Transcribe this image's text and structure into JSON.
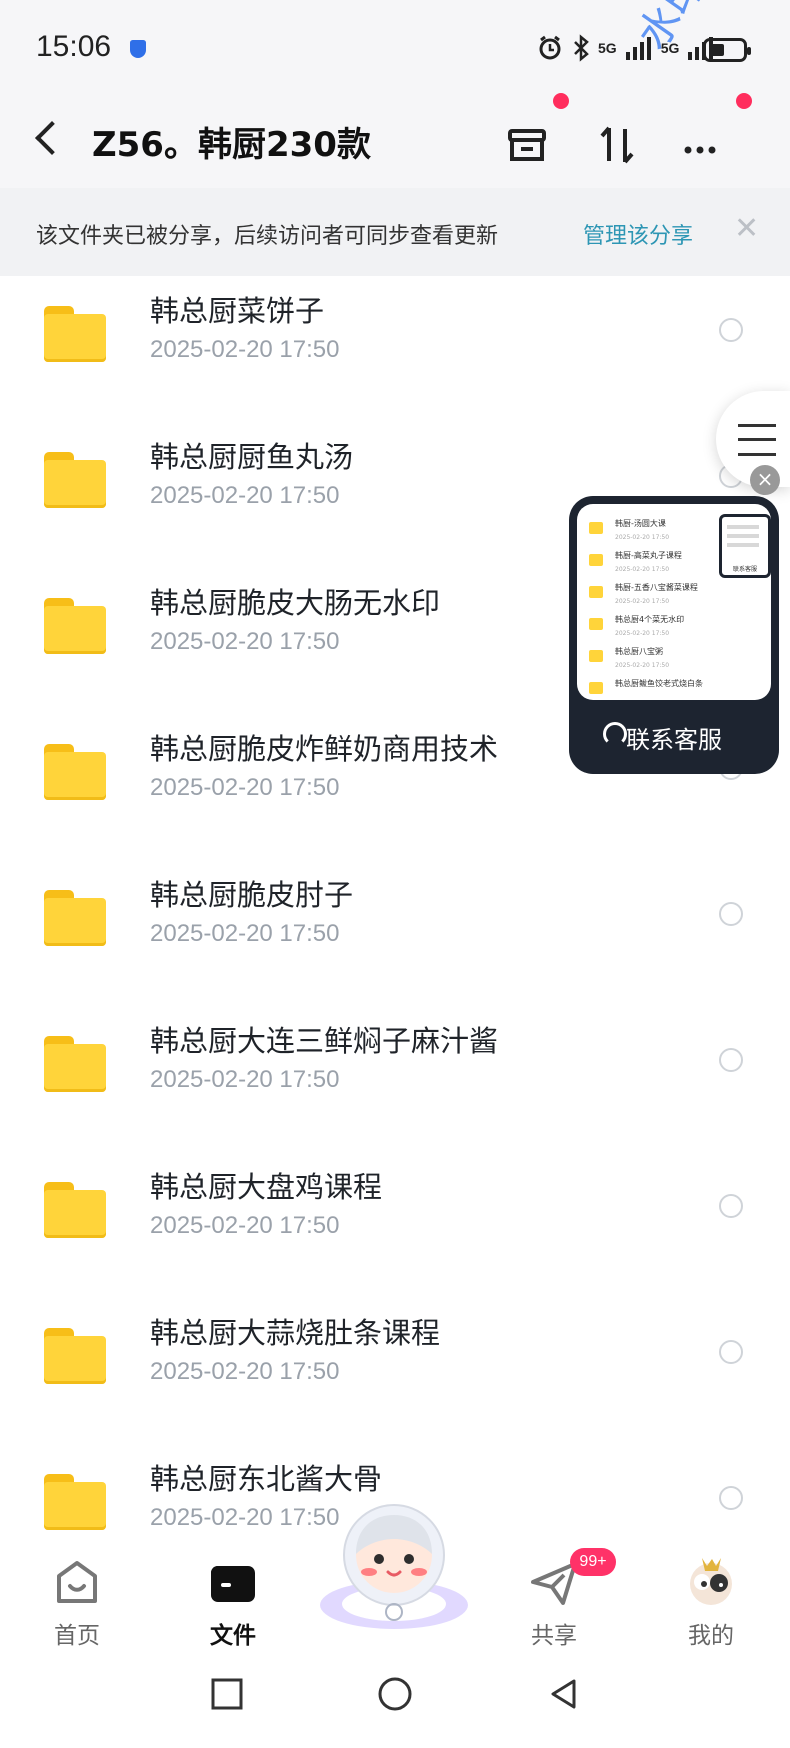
{
  "status_bar": {
    "time": "15:06",
    "network_1": "5G",
    "network_2": "5G",
    "watermark": "水印文字"
  },
  "header": {
    "title": "Z56。韩厨230款"
  },
  "share_banner": {
    "text": "该文件夹已被分享，后续访问者可同步查看更新",
    "manage_link": "管理该分享"
  },
  "files": [
    {
      "name": "韩总厨菜饼子",
      "date": "2025-02-20  17:50"
    },
    {
      "name": "韩总厨厨鱼丸汤",
      "date": "2025-02-20  17:50"
    },
    {
      "name": "韩总厨脆皮大肠无水印",
      "date": "2025-02-20  17:50"
    },
    {
      "name": "韩总厨脆皮炸鲜奶商用技术",
      "date": "2025-02-20  17:50"
    },
    {
      "name": "韩总厨脆皮肘子",
      "date": "2025-02-20  17:50"
    },
    {
      "name": "韩总厨大连三鲜焖子麻汁酱",
      "date": "2025-02-20  17:50"
    },
    {
      "name": "韩总厨大盘鸡课程",
      "date": "2025-02-20  17:50"
    },
    {
      "name": "韩总厨大蒜烧肚条课程",
      "date": "2025-02-20  17:50"
    },
    {
      "name": "韩总厨东北酱大骨",
      "date": "2025-02-20  17:50"
    }
  ],
  "support": {
    "label": "联系客服",
    "preview_items": [
      {
        "name": "韩厨-汤圆大课",
        "date": "2025-02-20  17:50"
      },
      {
        "name": "韩厨-高菜丸子课程",
        "date": "2025-02-20  17:50"
      },
      {
        "name": "韩厨-五香八宝酱菜课程",
        "date": "2025-02-20  17:50"
      },
      {
        "name": "韩总厨4个菜无水印",
        "date": "2025-02-20  17:50"
      },
      {
        "name": "韩总厨八宝粥",
        "date": "2025-02-20  17:50"
      },
      {
        "name": "韩总厨鲅鱼饺老式烧白条",
        "date": ""
      }
    ],
    "preview_phone_label": "联系客服"
  },
  "bottom_nav": {
    "tabs": [
      {
        "label": "首页",
        "active": false
      },
      {
        "label": "文件",
        "active": true
      },
      {
        "label": "共享",
        "active": false
      },
      {
        "label": "我的",
        "active": false
      }
    ],
    "share_badge": "99+"
  },
  "colors": {
    "accent": "#2d96b4",
    "badge": "#ff3268",
    "folder": "#ffd43a"
  }
}
